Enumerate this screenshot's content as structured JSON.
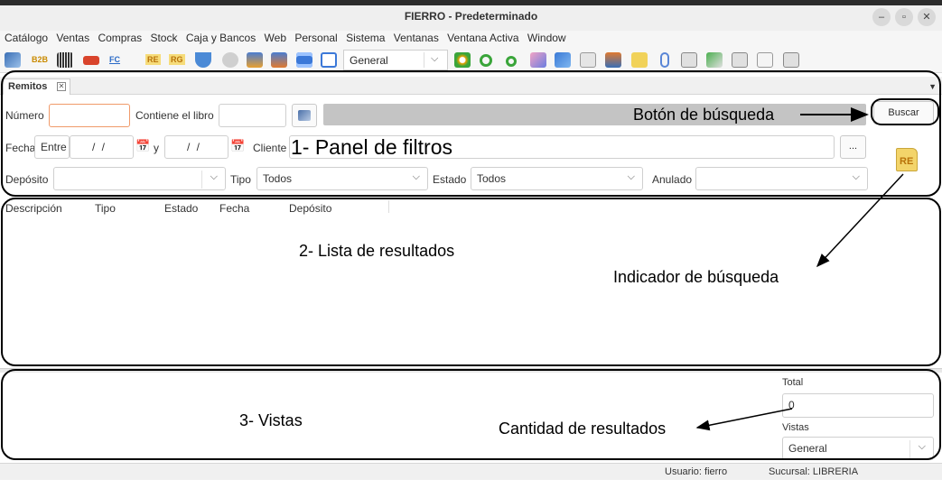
{
  "window": {
    "title": "FIERRO - Predeterminado",
    "controls": [
      "–",
      "▫",
      "✕"
    ]
  },
  "menu": [
    "Catálogo",
    "Ventas",
    "Compras",
    "Stock",
    "Caja y Bancos",
    "Web",
    "Personal",
    "Sistema",
    "Ventanas",
    "Ventana Activa",
    "Window"
  ],
  "toolbar": {
    "b2b_label": "B2B",
    "fc_label": "FC",
    "re_label": "RE",
    "rg_label": "RG",
    "view_select": "General"
  },
  "tab": {
    "label": "Remitos",
    "close": "✕"
  },
  "filters": {
    "numero_label": "Número",
    "numero_value": "",
    "libro_label": "Contiene el libro",
    "libro_value": "",
    "buscar_label": "Buscar",
    "fecha_label": "Fecha",
    "entre_label": "Entre",
    "fecha_desde": "/ /",
    "y_label": "y",
    "fecha_hasta": "/ /",
    "cliente_label": "Cliente",
    "cliente_value": "",
    "dots": "...",
    "deposito_label": "Depósito",
    "deposito_value": "",
    "tipo_label": "Tipo",
    "tipo_value": "Todos",
    "estado_label": "Estado",
    "estado_value": "Todos",
    "anulado_label": "Anulado",
    "anulado_value": "",
    "indicator_label": "RE"
  },
  "results": {
    "columns": [
      "Descripción",
      "Tipo",
      "Estado",
      "Fecha",
      "Depósito"
    ]
  },
  "views": {
    "total_label": "Total",
    "total_value": "0",
    "vistas_label": "Vistas",
    "vistas_value": "General"
  },
  "status": {
    "usuario": "Usuario: fierro",
    "sucursal": "Sucursal: LIBRERIA"
  },
  "annotations": {
    "boton_busqueda": "Botón de búsqueda",
    "panel_filtros": "1- Panel de filtros",
    "lista_resultados": "2- Lista de resultados",
    "indicador_busqueda": "Indicador de búsqueda",
    "vistas": "3- Vistas",
    "cantidad_resultados": "Cantidad de resultados"
  }
}
